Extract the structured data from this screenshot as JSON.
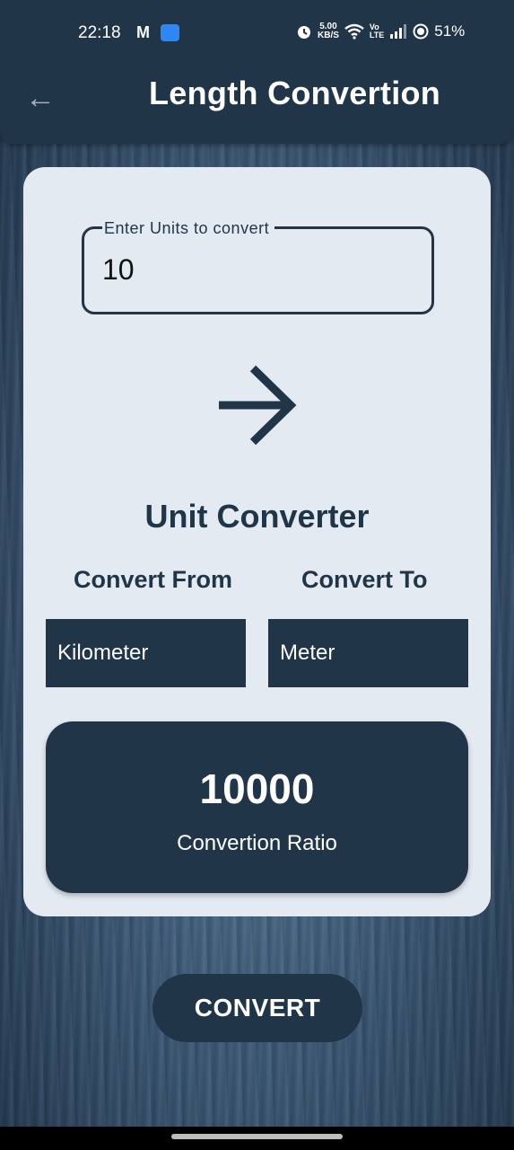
{
  "status_bar": {
    "time": "22:18",
    "gmail_icon": "M",
    "speed_value": "5.00",
    "speed_unit": "KB/S",
    "volte": "Vo\nLTE",
    "battery": "51%"
  },
  "app_bar": {
    "title": "Length Convertion",
    "back_icon": "←"
  },
  "input": {
    "label": "Enter Units to convert",
    "value": "10"
  },
  "converter": {
    "heading": "Unit Converter",
    "from_label": "Convert From",
    "to_label": "Convert To",
    "from_value": "Kilometer",
    "to_value": "Meter"
  },
  "result": {
    "value": "10000",
    "caption": "Convertion Ratio"
  },
  "actions": {
    "convert_label": "CONVERT"
  },
  "colors": {
    "primary": "#213549",
    "card": "#e4eaf2"
  }
}
